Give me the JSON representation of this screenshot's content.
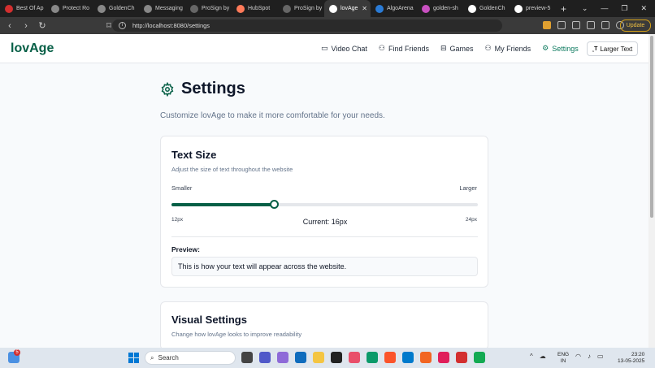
{
  "browser": {
    "tabs": [
      {
        "label": "Best Of Ap",
        "color": "#d32f2f"
      },
      {
        "label": "Protect Ro",
        "color": "#888888"
      },
      {
        "label": "GoldenCh",
        "color": "#888888"
      },
      {
        "label": "Messaging",
        "color": "#888888"
      },
      {
        "label": "ProSign by",
        "color": "#666666"
      },
      {
        "label": "HubSpot",
        "color": "#ff7a59"
      },
      {
        "label": "ProSign by",
        "color": "#666666"
      },
      {
        "label": "lovAge",
        "color": "#ffffff",
        "active": true
      },
      {
        "label": "AlgoArena",
        "color": "#2a7bd6"
      },
      {
        "label": "golden-sh",
        "color": "#c850c0"
      },
      {
        "label": "GoldenCh",
        "color": "#ffffff"
      },
      {
        "label": "preview-5",
        "color": "#ffffff"
      }
    ],
    "url": "http://localhost:8080/settings",
    "update_label": "Update"
  },
  "app": {
    "logo": "lovAge",
    "nav": [
      {
        "label": "Video Chat",
        "icon": "message-square-icon"
      },
      {
        "label": "Find Friends",
        "icon": "users-icon"
      },
      {
        "label": "Games",
        "icon": "gamepad-icon"
      },
      {
        "label": "My Friends",
        "icon": "user-friends-icon"
      },
      {
        "label": "Settings",
        "icon": "gear-icon",
        "active": true
      }
    ],
    "larger_text_button": "Larger Text",
    "accent_color": "#065f46"
  },
  "page": {
    "title": "Settings",
    "description": "Customize lovAge to make it more comfortable for your needs."
  },
  "text_size": {
    "title": "Text Size",
    "subtitle": "Adjust the size of text throughout the website",
    "smaller_label": "Smaller",
    "larger_label": "Larger",
    "min_label": "12px",
    "max_label": "24px",
    "current_label": "Current: 16px",
    "min": 12,
    "max": 24,
    "value": 16,
    "preview_label": "Preview:",
    "preview_text": "This is how your text will appear across the website."
  },
  "visual_settings": {
    "title": "Visual Settings",
    "subtitle": "Change how lovAge looks to improve readability"
  },
  "taskbar": {
    "search_label": "Search",
    "notification_count": "5",
    "lang_line1": "ENG",
    "lang_line2": "IN",
    "time": "23:20",
    "date": "13-05-2025"
  }
}
